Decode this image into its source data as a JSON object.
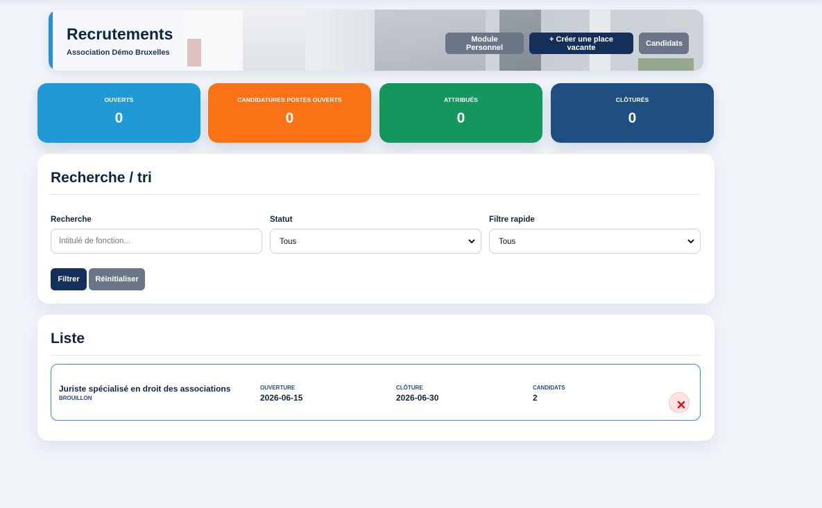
{
  "header": {
    "title": "Recrutements",
    "subtitle": "Association Démo Bruxelles",
    "buttons": {
      "module_personnel": "Module Personnel",
      "create_vacancy": "+ Créer une place vacante",
      "candidates": "Candidats"
    }
  },
  "stats": [
    {
      "label": "OUVERTS",
      "value": "0",
      "color": "#209ad6"
    },
    {
      "label": "CANDIDATURES POSTES OUVERTS",
      "value": "0",
      "color": "#f97316"
    },
    {
      "label": "ATTRIBUÉS",
      "value": "0",
      "color": "#13975f"
    },
    {
      "label": "CLÔTURÉS",
      "value": "0",
      "color": "#1f4e80"
    }
  ],
  "search": {
    "title": "Recherche / tri",
    "search_label": "Recherche",
    "search_placeholder": "Intitulé de fonction...",
    "search_value": "",
    "status_label": "Statut",
    "status_value": "Tous",
    "quick_filter_label": "Filtre rapide",
    "quick_filter_value": "Tous",
    "filter_button": "Filtrer",
    "reset_button": "Réinitialiser"
  },
  "list": {
    "title": "Liste",
    "items": [
      {
        "title": "Juriste spécialisé en droit des associations",
        "status": "BROUILLON",
        "opening_label": "OUVERTURE",
        "opening": "2026-06-15",
        "closing_label": "CLÔTURE",
        "closing": "2026-06-30",
        "candidates_label": "CANDIDATS",
        "candidates": "2"
      }
    ]
  },
  "colors": {
    "navy": "#14305a",
    "grey_button": "#6a7687",
    "delete_red": "#c81e1e"
  }
}
